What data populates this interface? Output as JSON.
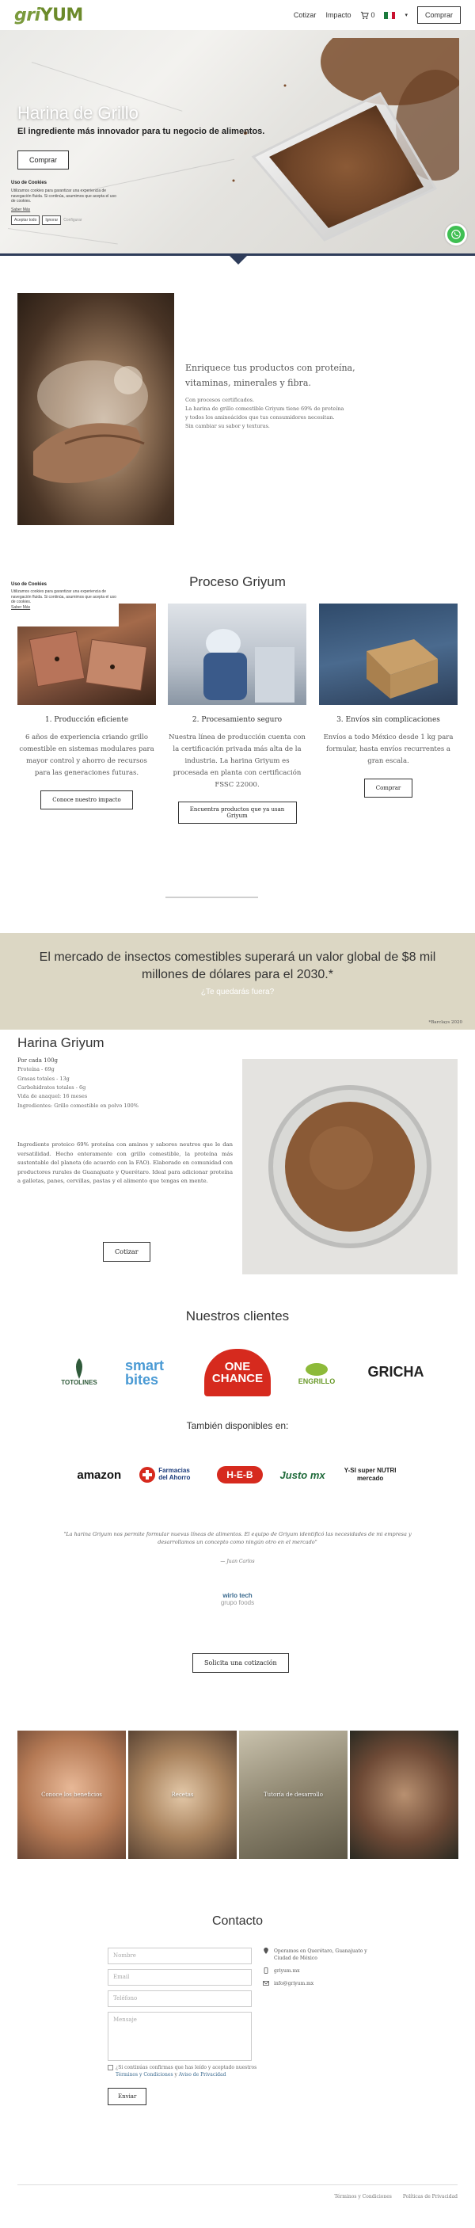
{
  "header": {
    "logo_left": "gri",
    "logo_right": "YUM",
    "nav": [
      "Cotizar",
      "Impacto"
    ],
    "cart_count": "0",
    "cta_label": "Comprar"
  },
  "hero": {
    "title": "Harina de Grillo",
    "subtitle": "El ingrediente más innovador para tu negocio de alimentos.",
    "button_label": "Comprar"
  },
  "cookie": {
    "title": "Uso de Cookies",
    "text": "Utilizamos cookies para garantizar una experiencia de navegación fluida. Si continúa, asumimos que acepta el uso de cookies.",
    "link": "Saber Más",
    "accept": "Aceptar todo",
    "reject": "Ignorar",
    "config": "Configurar"
  },
  "intro": {
    "heading": "Enriquece tus productos con proteína, vitaminas, minerales y fibra.",
    "lines": [
      "Con procesos certificados.",
      "La harina de grillo comestible Griyum tiene 69% de proteína",
      "y todos los aminoácidos que tus consumidores necesitan.",
      "Sin cambiar su sabor y texturas."
    ]
  },
  "proceso": {
    "title": "Proceso Griyum",
    "cookie_title": "Uso de Cookies",
    "cookie_text": "Utilizamos cookies para garantizar una experiencia de navegación fluida. Si continúa, asumimos que acepta el uso de cookies.",
    "cookie_link": "Saber Más",
    "columns": [
      {
        "title": "1. Producción eficiente",
        "body": "6 años de experiencia criando grillo comestible en sistemas modulares para mayor control y ahorro de recursos para las generaciones futuras.",
        "button": "Conoce nuestro impacto"
      },
      {
        "title": "2. Procesamiento seguro",
        "body": "Nuestra línea de producción cuenta con la certificación privada más alta de la industria. La harina Griyum es procesada en planta con certificación FSSC 22000.",
        "button": "Encuentra productos que ya usan Griyum"
      },
      {
        "title": "3. Envíos sin complicaciones",
        "body": "Envíos a todo México desde 1 kg para formular, hasta envíos recurrentes a gran escala.",
        "button": "Comprar"
      }
    ]
  },
  "banner": {
    "headline": "El mercado de insectos comestibles superará un valor global de $8 mil millones de dólares para el 2030.*",
    "question": "¿Te quedarás fuera?",
    "source": "*Barclays 2020"
  },
  "product": {
    "title": "Harina Griyum",
    "presentation": "Por cada 100g",
    "nutrition": [
      "Proteína - 69g",
      "Grasas totales - 13g",
      "Carbohidratos totales - 6g",
      "Vida de anaquel: 16 meses",
      "Ingredientes: Grillo comestible en polvo 100%"
    ],
    "description": "Ingrediente proteico 69% proteína con aminos y sabores neutros que le dan versatilidad. Hecho enteramente con grillo comestible, la proteína más sustentable del planeta (de acuerdo con la FAO). Elaborado en comunidad con productores rurales de Guanajuato y Querétaro. Ideal para adicionar proteína a galletas, panes, cervillas, pastas y el alimento que tengas en mente.",
    "button": "Cotizar"
  },
  "clients": {
    "title": "Nuestros clientes",
    "logos": [
      "TOTOLINES",
      "smart bites",
      "ONE CHANCE",
      "ENGRILLO",
      "GRICHA"
    ]
  },
  "available": {
    "title": "También disponibles en:",
    "stores": [
      "amazon",
      "Farmacias del Ahorro",
      "H-E-B",
      "Justo mx",
      "Y-SI super NUTRI mercado"
    ]
  },
  "testimonial": {
    "text": "\"La harina Griyum nos permite formular nuevas líneas de alimentos. El equipo de Griyum identificó las necesidades de mi empresa y desarrollamos un concepto como ningún otro en el mercado\"",
    "author": "— Juan Carlos",
    "logo_main": "wirlo tech",
    "logo_sub": "grupo foods"
  },
  "quote_button": "Solicita una cotización",
  "tiles": [
    {
      "label": "Conoce los beneficios"
    },
    {
      "label": "Recetas"
    },
    {
      "label": "Tutoría de desarrollo"
    },
    {
      "label": ""
    }
  ],
  "contact": {
    "title": "Contacto",
    "placeholders": [
      "Nombre",
      "Email",
      "Teléfono",
      "Mensaje"
    ],
    "terms_prefix": "¿Si continúas confirmas que has leído y aceptado nuestros",
    "terms_link1": "Términos y Condiciones",
    "terms_mid": "y",
    "terms_link2": "Aviso de Privacidad",
    "send": "Enviar",
    "info": [
      "Operamos en Querétaro, Guanajuato y Ciudad de México",
      "griyum.mx",
      "info@griyum.mx"
    ]
  },
  "footer": {
    "links": [
      "Términos y Condiciones",
      "Políticas de Privacidad"
    ]
  },
  "colors": {
    "brand_green": "#7a9a3c",
    "navy": "#2e3c5a",
    "banner_bg": "#dcd7c4",
    "whatsapp": "#3fbf52"
  }
}
